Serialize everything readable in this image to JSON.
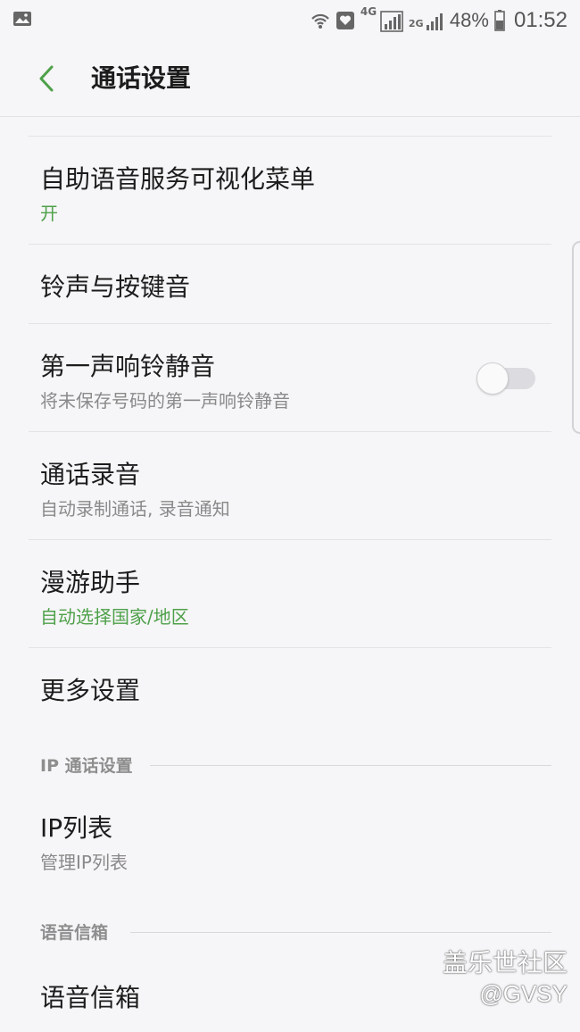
{
  "status_bar": {
    "left_icon": "gallery-icon",
    "network_4g": "4G",
    "network_2g": "2G",
    "battery_percent": "48%",
    "time": "01:52"
  },
  "app_bar": {
    "back_icon": "chevron-left-icon",
    "title": "通话设置"
  },
  "colors": {
    "accent_green": "#4ea14a",
    "background": "#f6f5f7"
  },
  "settings": {
    "visual_voice_menu": {
      "title": "自助语音服务可视化菜单",
      "subtitle": "开"
    },
    "ringtones": {
      "title": "铃声与按键音"
    },
    "first_ring_mute": {
      "title": "第一声响铃静音",
      "subtitle": "将未保存号码的第一声响铃静音",
      "enabled": false
    },
    "call_recording": {
      "title": "通话录音",
      "subtitle": "自动录制通话, 录音通知"
    },
    "roaming_assistant": {
      "title": "漫游助手",
      "subtitle": "自动选择国家/地区"
    },
    "more_settings": {
      "title": "更多设置"
    }
  },
  "sections": {
    "ip_call": {
      "header": "IP 通话设置",
      "ip_list": {
        "title": "IP列表",
        "subtitle": "管理IP列表"
      }
    },
    "voicemail": {
      "header": "语音信箱",
      "voicemail_item": {
        "title": "语音信箱"
      }
    }
  },
  "watermark": {
    "line1": "盖乐世社区",
    "line2": "@GVSY"
  }
}
